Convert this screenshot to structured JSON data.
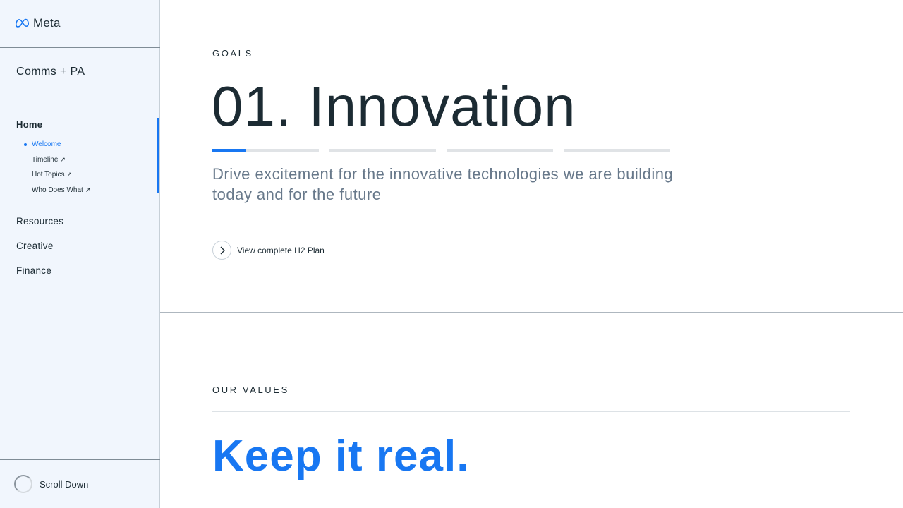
{
  "brand": {
    "name": "Meta",
    "logo_icon": "meta-infinity-icon",
    "accent": "#1877f2"
  },
  "sidebar": {
    "workspace": "Comms + PA",
    "home": "Home",
    "subnav": [
      {
        "label": "Welcome",
        "active": true,
        "external": false
      },
      {
        "label": "Timeline",
        "active": false,
        "external": true,
        "ext_glyph": "↗"
      },
      {
        "label": "Hot Topics",
        "active": false,
        "external": true,
        "ext_glyph": "↗"
      },
      {
        "label": "Who Does What",
        "active": false,
        "external": true,
        "ext_glyph": "↗"
      }
    ],
    "main_items": [
      "Resources",
      "Creative",
      "Finance"
    ],
    "scroll_label": "Scroll Down"
  },
  "goals": {
    "eyebrow": "GOALS",
    "title": "01. Innovation",
    "progress": {
      "segments": 4,
      "current": 1,
      "current_fill_fraction": 0.32
    },
    "description": "Drive excitement for the innovative technologies we are building today and for the future",
    "plan_link": "View complete H2 Plan"
  },
  "values": {
    "eyebrow": "OUR VALUES",
    "title": "Keep it real."
  }
}
